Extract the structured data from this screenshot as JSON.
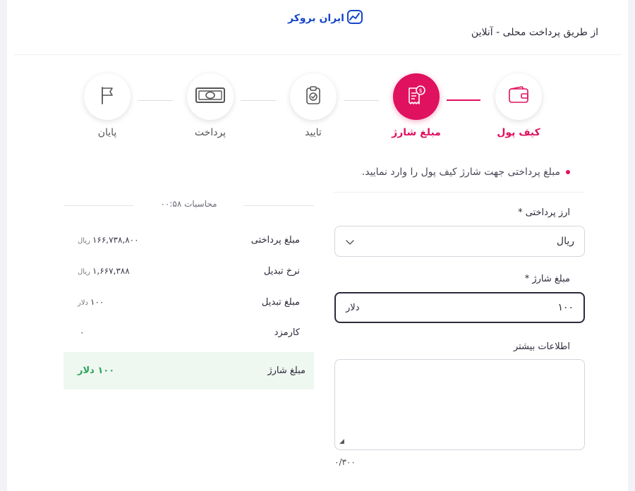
{
  "brand": {
    "logo_text": "ایران بروکر",
    "color": "#1746c9"
  },
  "header": {
    "title": "از طریق پرداخت محلی - آنلاین"
  },
  "accent_color": "#e0115f",
  "steps": [
    {
      "label": "کیف پول",
      "icon": "wallet-icon",
      "state": "completed"
    },
    {
      "label": "مبلغ شارژ",
      "icon": "invoice-dollar-icon",
      "state": "active"
    },
    {
      "label": "تایید",
      "icon": "clipboard-check-icon",
      "state": "pending"
    },
    {
      "label": "پرداخت",
      "icon": "banknote-icon",
      "state": "pending"
    },
    {
      "label": "پایان",
      "icon": "flag-icon",
      "state": "pending"
    }
  ],
  "instruction": "مبلغ پرداختی جهت شارژ کیف پول را وارد نمایید.",
  "form": {
    "currency_label": "ارز پرداختی *",
    "currency_value": "ریال",
    "amount_label": "مبلغ شارژ *",
    "amount_value": "۱۰۰",
    "amount_unit": "دلار",
    "info_label": "اطلاعات بیشتر",
    "info_value": "",
    "char_count": "۰/۳۰۰"
  },
  "calculation": {
    "title": "محاسبات ۰۰:۵۸",
    "rows": [
      {
        "label": "مبلغ پرداختی",
        "value": "۱۶۶,۷۳۸,۸۰۰",
        "unit": "ریال"
      },
      {
        "label": "نرخ تبدیل",
        "value": "۱,۶۶۷,۳۸۸",
        "unit": "ریال"
      },
      {
        "label": "مبلغ تبدیل",
        "value": "۱۰۰",
        "unit": "دلار"
      },
      {
        "label": "کارمزد",
        "value": "۰",
        "unit": ""
      }
    ],
    "total": {
      "label": "مبلغ شارژ",
      "value": "۱۰۰ دلار",
      "color": "#2fa35a"
    }
  }
}
